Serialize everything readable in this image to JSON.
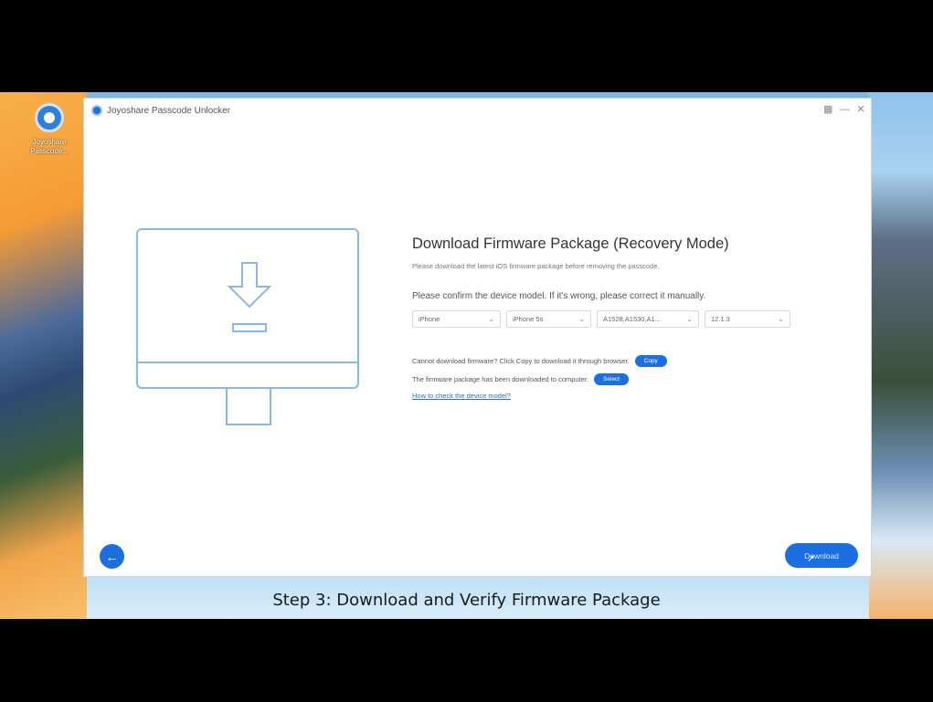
{
  "desktop": {
    "icon_label": "Joyoshare Passcode..."
  },
  "window": {
    "title": "Joyoshare Passcode Unlocker",
    "controls": [
      "▦",
      "—",
      "✕"
    ]
  },
  "main": {
    "title": "Download Firmware Package (Recovery Mode)",
    "subtitle": "Please download the latest iOS firmware package before removing the passcode.",
    "confirm_text": "Please confirm the device model. If it's wrong, please correct it manually.",
    "selects": [
      {
        "value": "iPhone",
        "width": 97
      },
      {
        "value": "iPhone 5s",
        "width": 93
      },
      {
        "value": "A1528,A1530,A1...",
        "width": 112
      },
      {
        "value": "12.1.3",
        "width": 94
      }
    ],
    "cannot_download_text": "Cannot download firmware? Click Copy to download it through browser.",
    "copy_label": "Copy",
    "downloaded_text": "The firmware package has been downloaded to computer.",
    "select_label": "Select",
    "help_link": "How to check the device model?"
  },
  "footer": {
    "back_icon": "arrow-left",
    "download_label": "Download"
  },
  "caption": "Step 3: Download and Verify Firmware Package",
  "colors": {
    "accent": "#1c6fe0",
    "illustration": "#8cb6e6"
  }
}
